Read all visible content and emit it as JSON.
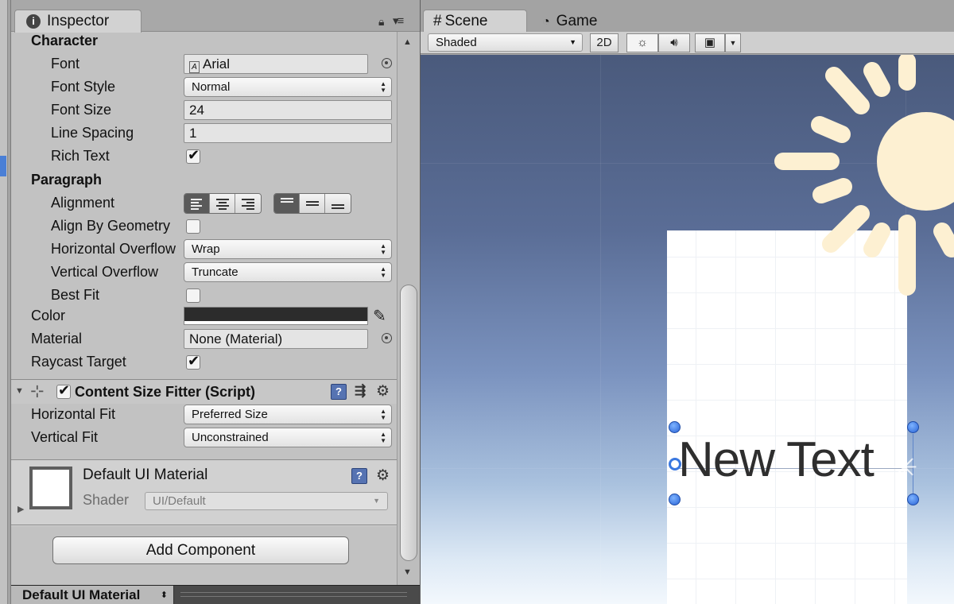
{
  "inspector": {
    "tab_label": "Inspector",
    "character_header": "Character",
    "font_label": "Font",
    "font_value": "Arial",
    "font_style_label": "Font Style",
    "font_style_value": "Normal",
    "font_size_label": "Font Size",
    "font_size_value": "24",
    "line_spacing_label": "Line Spacing",
    "line_spacing_value": "1",
    "rich_text_label": "Rich Text",
    "rich_text_checked": true,
    "paragraph_header": "Paragraph",
    "alignment_label": "Alignment",
    "horizontal_alignment": "left",
    "vertical_alignment": "top",
    "align_by_geometry_label": "Align By Geometry",
    "align_by_geometry_checked": false,
    "horizontal_overflow_label": "Horizontal Overflow",
    "horizontal_overflow_value": "Wrap",
    "vertical_overflow_label": "Vertical Overflow",
    "vertical_overflow_value": "Truncate",
    "best_fit_label": "Best Fit",
    "best_fit_checked": false,
    "color_label": "Color",
    "color_value": "#2c2c2c",
    "material_label": "Material",
    "material_value": "None (Material)",
    "raycast_target_label": "Raycast Target",
    "raycast_target_checked": true
  },
  "content_size_fitter": {
    "title": "Content Size Fitter (Script)",
    "enabled": true,
    "horizontal_fit_label": "Horizontal Fit",
    "horizontal_fit_value": "Preferred Size",
    "vertical_fit_label": "Vertical Fit",
    "vertical_fit_value": "Unconstrained"
  },
  "material_section": {
    "name": "Default UI Material",
    "shader_label": "Shader",
    "shader_value": "UI/Default"
  },
  "add_component_label": "Add Component",
  "preview_bar": {
    "name": "Default UI Material"
  },
  "scene": {
    "scene_tab_label": "Scene",
    "game_tab_label": "Game",
    "shading_mode": "Shaded",
    "mode_2d_label": "2D",
    "text_object": "New Text"
  },
  "colors": {
    "selection": "#4a7fd6",
    "handle": "#3a78e0",
    "sun": "#fdf0d2"
  },
  "icons": [
    "info-icon",
    "lock-icon",
    "menu-icon",
    "target-icon",
    "eyedropper-icon",
    "script-icon",
    "help-icon",
    "presets-icon",
    "gear-icon",
    "grid-icon",
    "pacman-icon",
    "sun-icon",
    "audio-icon",
    "image-icon",
    "chevron-down-icon"
  ]
}
